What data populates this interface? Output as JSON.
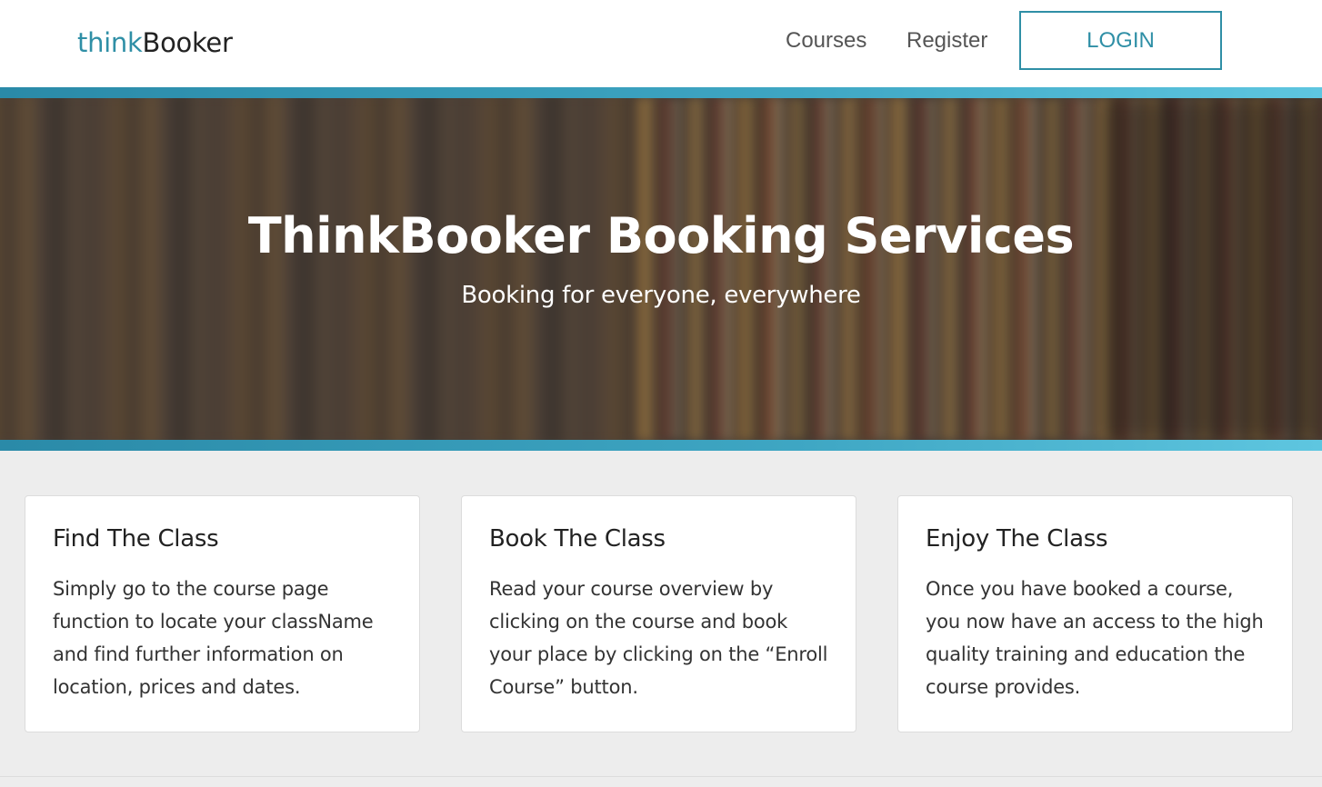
{
  "navbar": {
    "brand_think": "think",
    "brand_booker": "Booker",
    "links": {
      "courses": "Courses",
      "register": "Register"
    },
    "login_label": "LOGIN"
  },
  "hero": {
    "title": "ThinkBooker Booking Services",
    "subtitle": "Booking for everyone, everywhere"
  },
  "cards": [
    {
      "title": "Find The Class",
      "text": "Simply go to the course page function to locate your className and find further information on location, prices and dates."
    },
    {
      "title": "Book The Class",
      "text": "Read your course overview by clicking on the course and book your place by clicking on the “Enroll Course” button."
    },
    {
      "title": "Enjoy The Class",
      "text": "Once you have booked a course, you now have an access to the high quality training and education the course provides."
    }
  ],
  "colors": {
    "accent": "#2f8fa6",
    "accent_bar_end": "#5ec6e0",
    "page_background": "#ededed"
  }
}
